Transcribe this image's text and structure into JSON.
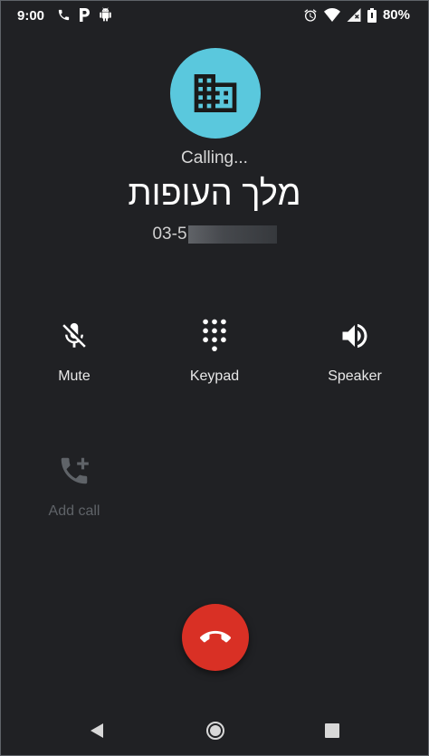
{
  "status_bar": {
    "time": "9:00",
    "battery_percent": "80%",
    "left_icons": [
      "phone-icon",
      "parking-icon",
      "android-icon"
    ],
    "right_icons": [
      "alarm-icon",
      "wifi-icon",
      "signal-icon",
      "battery-icon"
    ]
  },
  "call": {
    "state": "Calling...",
    "caller_name": "מלך העופות",
    "caller_number_visible": "03-5",
    "avatar_icon": "business-icon",
    "avatar_color": "#5ac8dd"
  },
  "controls": {
    "mute": {
      "label": "Mute",
      "icon": "mic-off-icon"
    },
    "keypad": {
      "label": "Keypad",
      "icon": "dialpad-icon"
    },
    "speaker": {
      "label": "Speaker",
      "icon": "volume-icon"
    },
    "add_call": {
      "label": "Add call",
      "icon": "add-call-icon",
      "enabled": false
    }
  },
  "end_call": {
    "icon": "end-call-icon",
    "color": "#d93025"
  },
  "nav": {
    "icons": [
      "back-icon",
      "home-icon",
      "recents-icon"
    ]
  },
  "colors": {
    "background": "#202124",
    "text_primary": "#ffffff",
    "text_disabled": "#5f6368"
  }
}
